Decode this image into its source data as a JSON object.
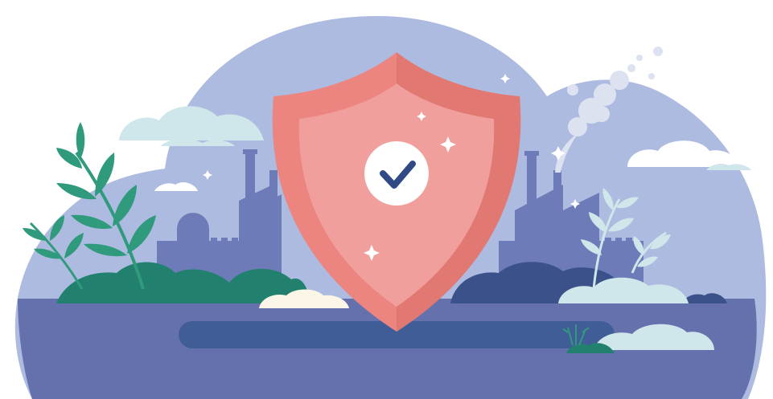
{
  "scene": {
    "subject": "shield-with-checkmark",
    "palette": {
      "background": "#ffffff",
      "sky_blob": "#aebbe0",
      "factory_silhouette": "#6d7cb8",
      "factory_dark": "#5b68a8",
      "ground": "#6571ad",
      "ground_band": "#415d98",
      "shield_outer": "#ec8580",
      "shield_outer_shade": "#e17872",
      "shield_inner": "#f09f9c",
      "check_circle": "#ffffff",
      "check_mark": "#2f4a84",
      "cloud_light": "#cfe6ea",
      "cloud_white": "#ffffff",
      "cloud_cream": "#fbf6e8",
      "bush_green": "#22806e",
      "bush_navy": "#3a5189",
      "plant_green": "#2f9a7c",
      "plant_pale": "#cfe6ea",
      "smoke": "#dde2f1",
      "sparkle": "#ffffff"
    },
    "icons": [
      "shield-icon",
      "checkmark-icon",
      "factory-icon",
      "smoke-icon",
      "cloud-icon",
      "plant-icon",
      "sparkle-icon"
    ]
  }
}
